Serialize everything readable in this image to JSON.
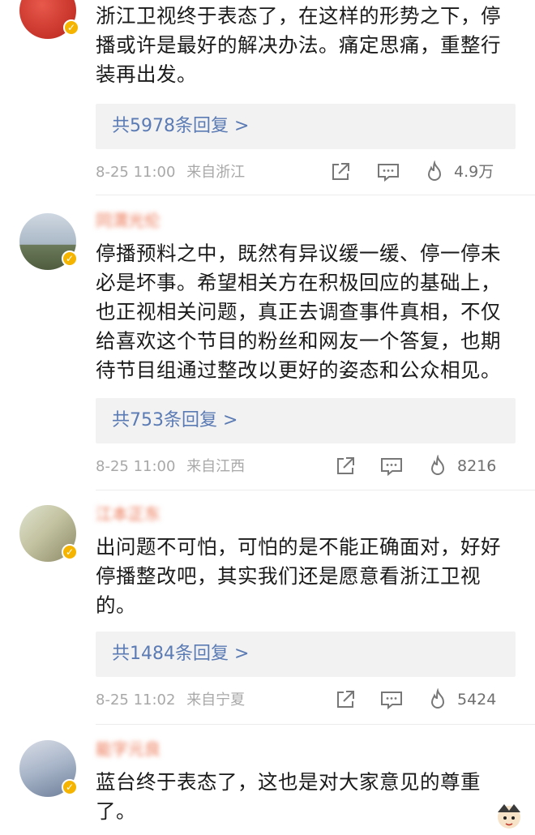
{
  "comments": [
    {
      "name": "",
      "text": "浙江卫视终于表态了，在这样的形势之下，停播或许是最好的解决办法。痛定思痛，重整行装再出发。",
      "reply_label": "共5978条回复 >",
      "time": "8-25 11:00",
      "source": "来自浙江",
      "likes": "4.9万",
      "avatar_color": "#d43a2f"
    },
    {
      "name": "同渭光伦",
      "text": "停播预料之中，既然有异议缓一缓、停一停未必是坏事。希望相关方在积极回应的基础上，也正视相关问题，真正去调查事件真相，不仅给喜欢这个节目的粉丝和网友一个答复，也期待节目组通过整改以更好的姿态和公众相见。",
      "reply_label": "共753条回复 >",
      "time": "8-25 11:00",
      "source": "来自江西",
      "likes": "8216",
      "avatar_color": "#8fa3b8"
    },
    {
      "name": "江本正东",
      "text": "出问题不可怕，可怕的是不能正确面对，好好停播整改吧，其实我们还是愿意看浙江卫视的。",
      "reply_label": "共1484条回复 >",
      "time": "8-25 11:02",
      "source": "来自宁夏",
      "likes": "5424",
      "avatar_color": "#b9b08a"
    },
    {
      "name": "能字元良",
      "text": "蓝台终于表态了，这也是对大家意见的尊重了。",
      "avatar_color": "#7d8ea6"
    }
  ],
  "icons": {
    "share": "share-icon",
    "comment": "comment-icon",
    "like": "like-icon"
  },
  "colors": {
    "reply_link": "#5b7bb4",
    "meta": "#a8a8a8",
    "badge": "#f5b400",
    "name": "#eb7350"
  }
}
